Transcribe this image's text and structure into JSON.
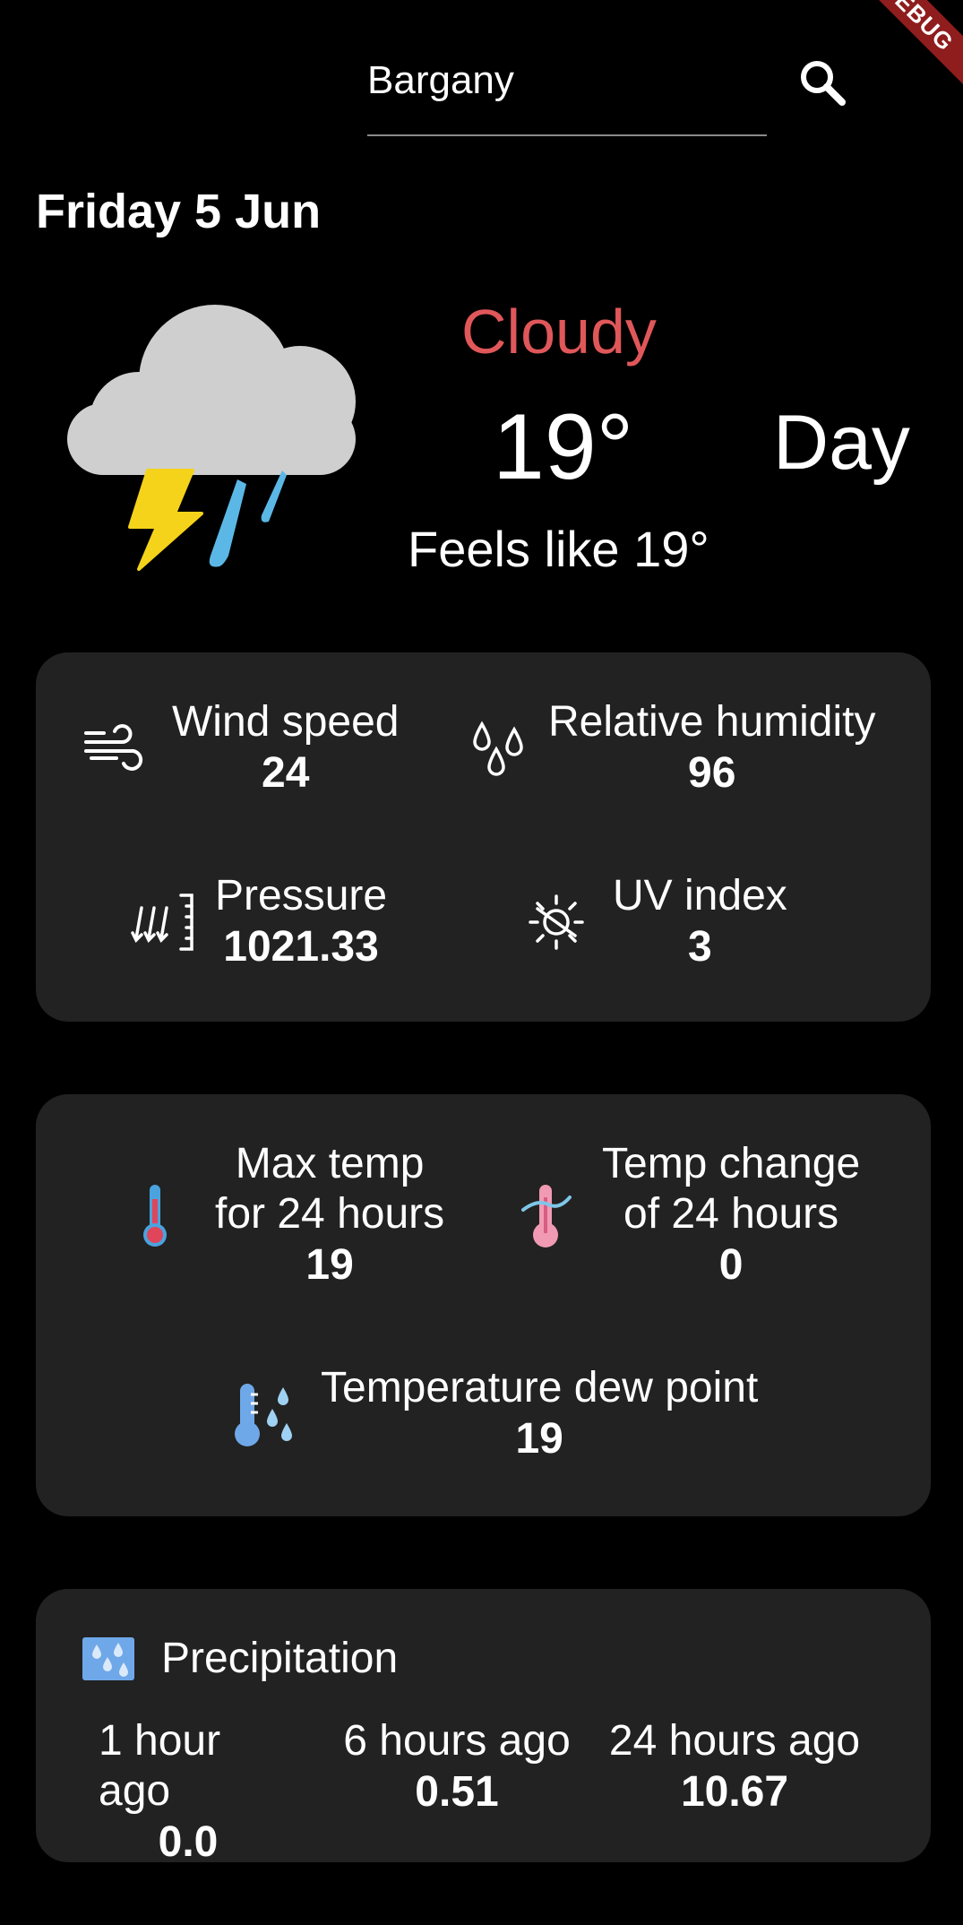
{
  "debug_banner": "DEBUG",
  "search": {
    "value": "Bargany"
  },
  "date": "Friday 5 Jun",
  "current": {
    "condition": "Cloudy",
    "temperature": "19°",
    "period": "Day",
    "feels_like": "Feels like 19°"
  },
  "card1": {
    "wind": {
      "label": "Wind speed",
      "value": "24"
    },
    "humidity": {
      "label": "Relative humidity",
      "value": "96"
    },
    "pressure": {
      "label": "Pressure",
      "value": "1021.33"
    },
    "uv": {
      "label": "UV index",
      "value": "3"
    }
  },
  "card2": {
    "max_temp": {
      "label_line1": "Max temp",
      "label_line2": "for 24 hours",
      "value": "19"
    },
    "temp_change": {
      "label_line1": "Temp change",
      "label_line2": "of 24 hours",
      "value": "0"
    },
    "dew_point": {
      "label": "Temperature dew point",
      "value": "19"
    }
  },
  "precipitation": {
    "title": "Precipitation",
    "periods": [
      {
        "label": "1 hour ago",
        "value": "0.0"
      },
      {
        "label": "6 hours ago",
        "value": "0.51"
      },
      {
        "label": "24 hours ago",
        "value": "10.67"
      }
    ]
  },
  "colors": {
    "background": "#000000",
    "card": "#222222",
    "condition": "#e0575a",
    "bolt": "#f5d31a",
    "rain": "#5bb8e6",
    "cloud": "#cfcfcf"
  },
  "icons": [
    "search-icon",
    "storm-cloud-icon",
    "wind-icon",
    "droplets-icon",
    "pressure-icon",
    "uv-sun-icon",
    "thermometer-icon",
    "thermometer-change-icon",
    "dew-point-icon",
    "precipitation-icon"
  ]
}
